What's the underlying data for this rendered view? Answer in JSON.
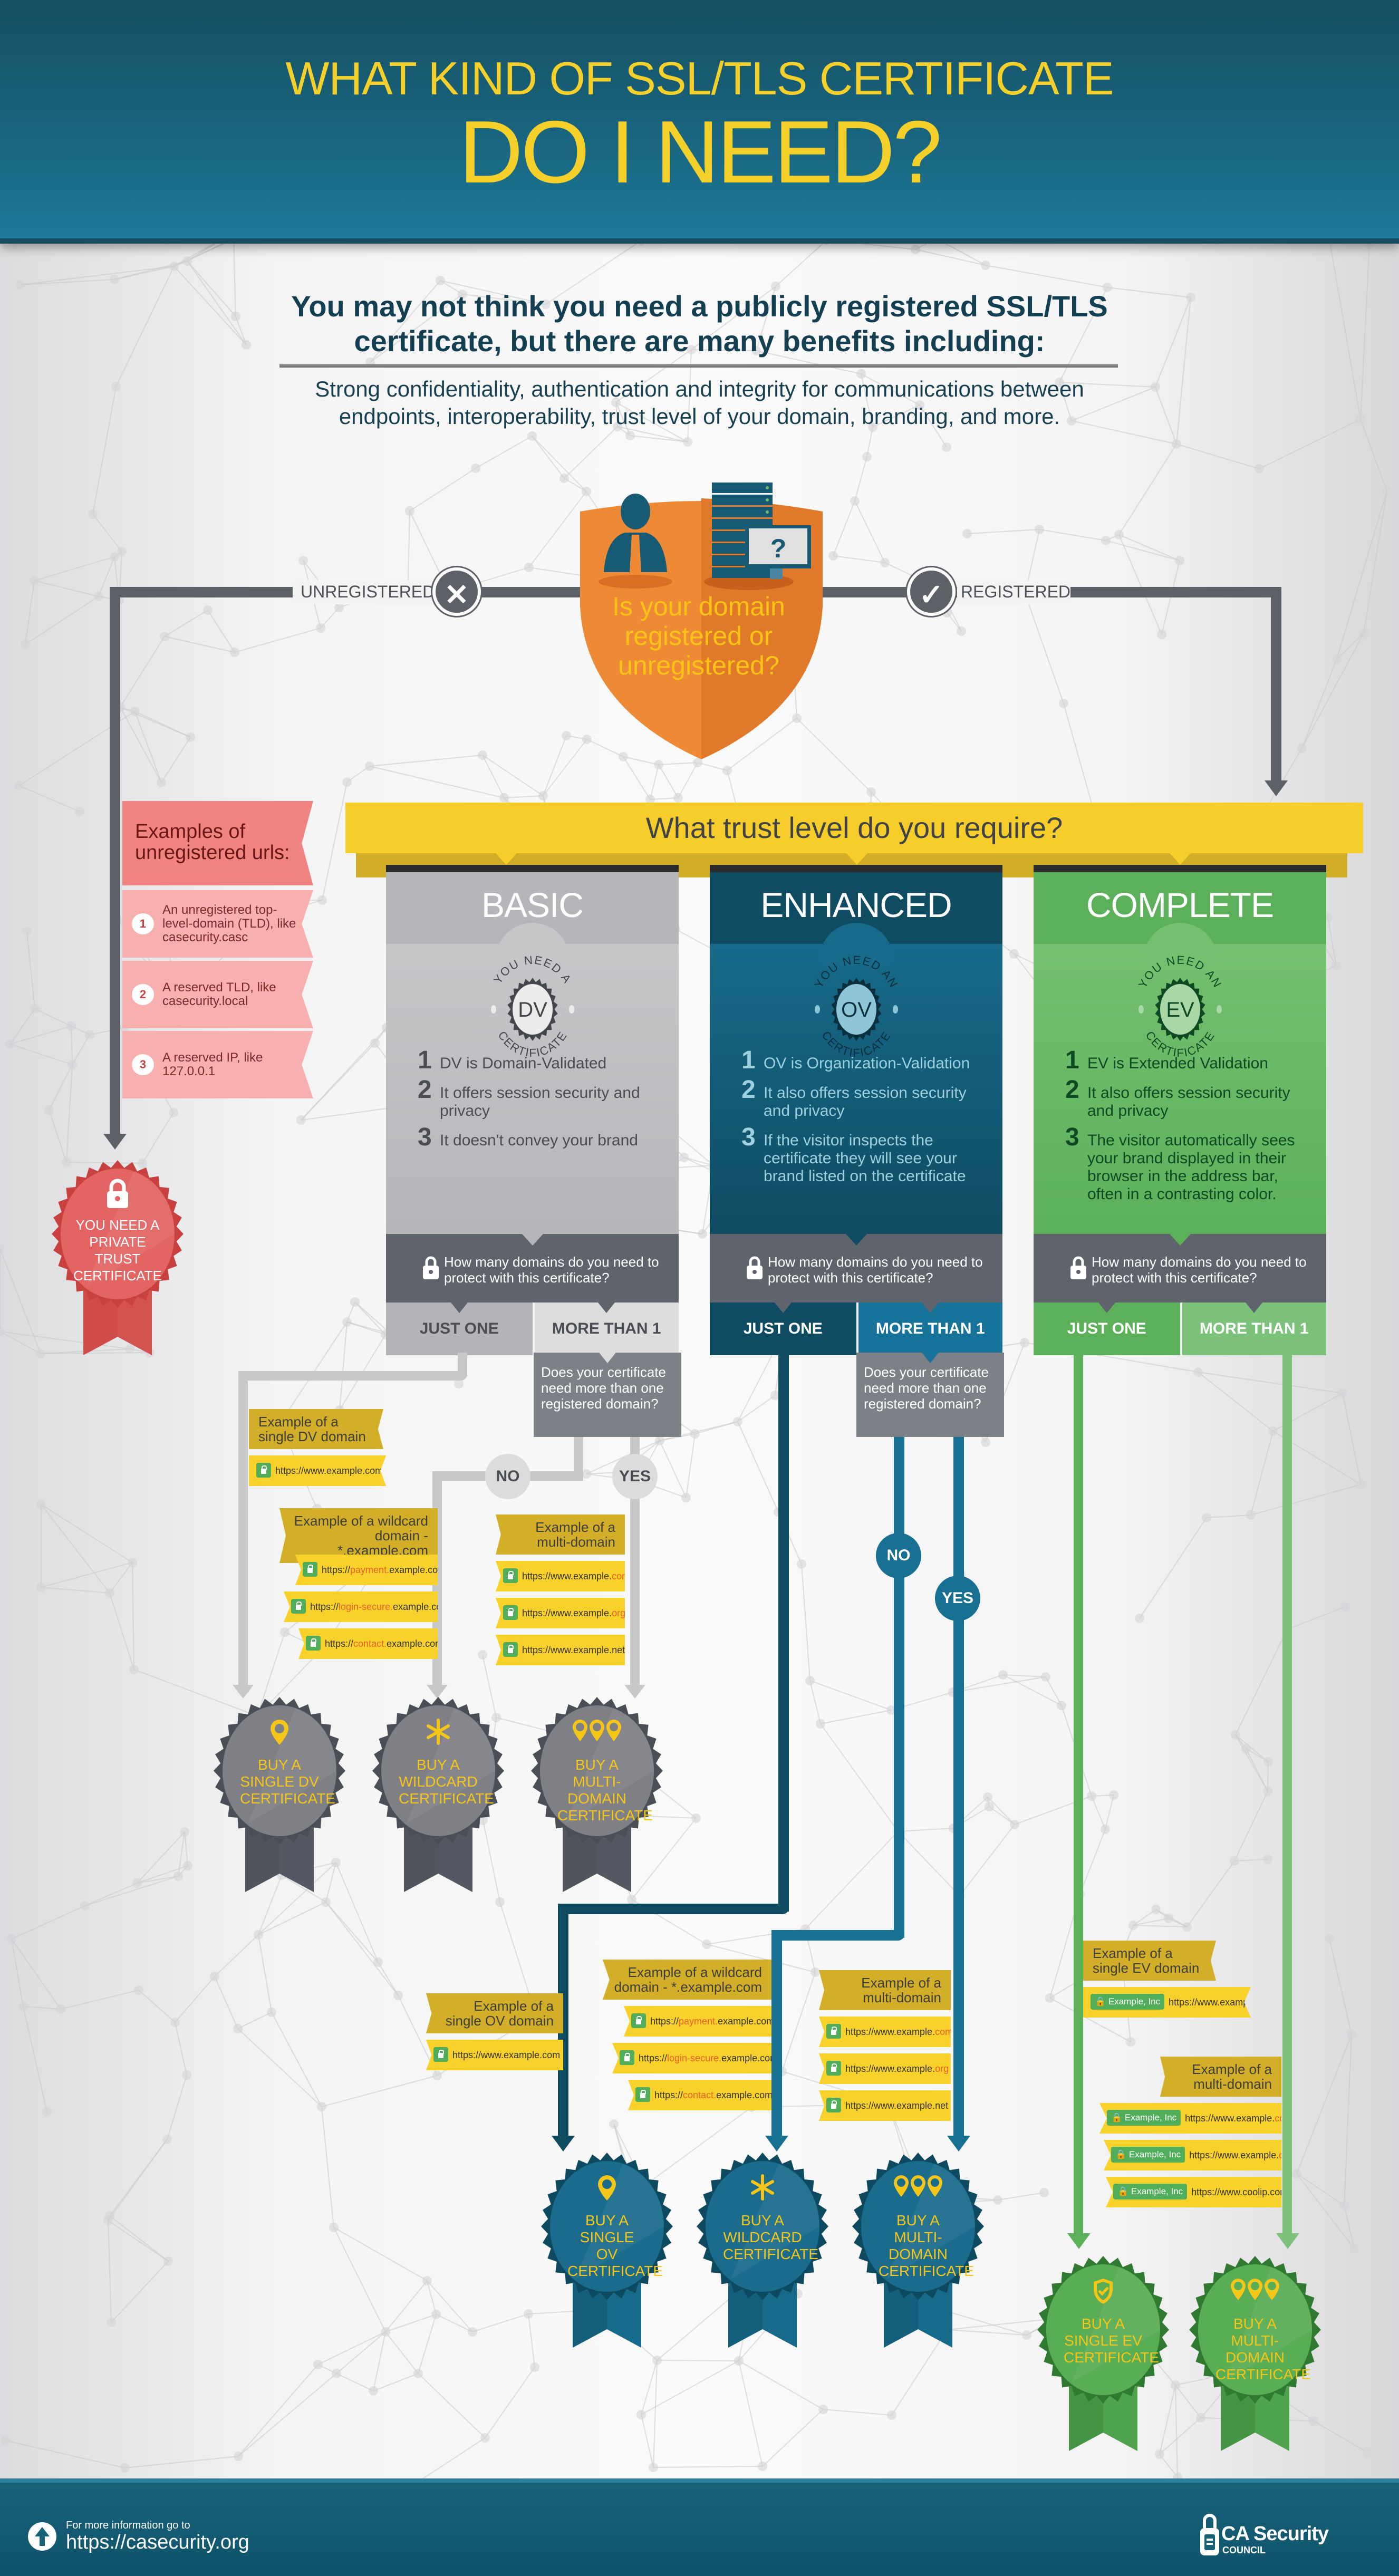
{
  "header": {
    "title_line1": "WHAT KIND OF SSL/TLS CERTIFICATE",
    "title_line2": "DO I NEED?"
  },
  "intro": {
    "headline": "You may not think you need a publicly registered SSL/TLS certificate, but there are many benefits including:",
    "body": "Strong confidentiality, authentication and integrity for communications between endpoints, interoperability, trust level of your domain, branding, and more."
  },
  "decision": {
    "question": "Is your domain registered or unregistered?",
    "unregistered_label": "UNREGISTERED",
    "registered_label": "REGISTERED",
    "unregistered_icon": "x-icon",
    "registered_icon": "check-icon"
  },
  "unregistered": {
    "heading": "Examples of unregistered urls:",
    "items": [
      {
        "num": "1",
        "text": "An unregistered top-level-domain (TLD), like casecurity.casc"
      },
      {
        "num": "2",
        "text": "A reserved TLD, like casecurity.local"
      },
      {
        "num": "3",
        "text": "A reserved IP, like 127.0.0.1"
      }
    ],
    "result": "YOU NEED A PRIVATE TRUST CERTIFICATE"
  },
  "trust": {
    "question": "What trust level do you require?",
    "domains_question": "How many domains do you need to protect with this certificate?",
    "option_one": "JUST ONE",
    "option_many": "MORE THAN 1",
    "multi_question": "Does your certificate need more than one registered domain?",
    "no_label": "NO",
    "yes_label": "YES",
    "levels": [
      {
        "name": "BASIC",
        "seal_top": "YOU NEED A",
        "seal_code": "DV",
        "seal_bottom": "CERTIFICATE",
        "features": [
          "DV is Domain-Validated",
          "It offers session security and privacy",
          "It doesn't convey your brand"
        ],
        "colors": {
          "head": "#b6b6ba",
          "body": "#c6c6c9",
          "text": "#4a4d53",
          "opt_one": "#b4b4b8",
          "opt_many": "#dcdcdc",
          "line": "#c8c8cb"
        }
      },
      {
        "name": "ENHANCED",
        "seal_top": "YOU NEED AN",
        "seal_code": "OV",
        "seal_bottom": "CERTIFICATE",
        "features": [
          "OV is Organization-Validation",
          "It also offers session security and privacy",
          "If the visitor inspects the certificate they will see your brand listed on the certificate"
        ],
        "colors": {
          "head": "#0f4b61",
          "body": "#176a8a",
          "text": "#9ed0df",
          "opt_one": "#0f4b61",
          "opt_many": "#18739a",
          "line": "#176f92"
        }
      },
      {
        "name": "COMPLETE",
        "seal_top": "YOU NEED AN",
        "seal_code": "EV",
        "seal_bottom": "CERTIFICATE",
        "features": [
          "EV is Extended Validation",
          "It also offers session security and privacy",
          "The visitor automatically sees your brand displayed in their browser in the address bar, often in a contrasting color."
        ],
        "colors": {
          "head": "#5cb05a",
          "body": "#74c070",
          "text": "#0d4a24",
          "opt_one": "#5cb05a",
          "opt_many": "#7cc27a",
          "line": "#5cb05a"
        }
      }
    ]
  },
  "examples": {
    "dv_single": {
      "heading": "Example of a single DV domain",
      "urls": [
        {
          "pre": "https://www.example.com",
          "hi": "",
          "post": ""
        }
      ]
    },
    "dv_wildcard": {
      "heading": "Example of a wildcard domain - *.example.com",
      "urls": [
        {
          "pre": "https://",
          "hi": "payment.",
          "post": "example.com"
        },
        {
          "pre": "https://",
          "hi": "login-secure.",
          "post": "example.com"
        },
        {
          "pre": "https://",
          "hi": "contact.",
          "post": "example.com"
        }
      ]
    },
    "dv_multi": {
      "heading": "Example of a multi-domain",
      "urls": [
        {
          "pre": "https://www.example.",
          "hi": "com",
          "post": ""
        },
        {
          "pre": "https://www.example.",
          "hi": "org",
          "post": ""
        },
        {
          "pre": "https://www.example.net",
          "hi": "",
          "post": ""
        }
      ]
    },
    "ov_single": {
      "heading": "Example of a single OV domain",
      "urls": [
        {
          "pre": "https://www.example.com",
          "hi": "",
          "post": ""
        }
      ]
    },
    "ov_wildcard": {
      "heading": "Example of a wildcard domain - *.example.com",
      "urls": [
        {
          "pre": "https://",
          "hi": "payment.",
          "post": "example.com"
        },
        {
          "pre": "https://",
          "hi": "login-secure.",
          "post": "example.com"
        },
        {
          "pre": "https://",
          "hi": "contact.",
          "post": "example.com"
        }
      ]
    },
    "ov_multi": {
      "heading": "Example of a multi-domain",
      "urls": [
        {
          "pre": "https://www.example.",
          "hi": "com",
          "post": ""
        },
        {
          "pre": "https://www.example.",
          "hi": "org",
          "post": ""
        },
        {
          "pre": "https://www.example.net",
          "hi": "",
          "post": ""
        }
      ]
    },
    "ev_single": {
      "heading": "Example of a single EV domain",
      "org": "Example, Inc",
      "urls": [
        {
          "pre": "https://www.example.com",
          "hi": "",
          "post": ""
        }
      ]
    },
    "ev_multi": {
      "heading": "Example of a multi-domain",
      "org": "Example, Inc",
      "urls": [
        {
          "pre": "https://www.example.",
          "hi": "com",
          "post": ""
        },
        {
          "pre": "https://www.example.",
          "hi": "org",
          "post": ""
        },
        {
          "pre": "https://www.coolip.com",
          "hi": "",
          "post": ""
        }
      ]
    }
  },
  "badges": {
    "dv_single": "BUY A SINGLE DV CERTIFICATE",
    "dv_wildcard": "BUY A WILDCARD CERTIFICATE",
    "dv_multi": "BUY A MULTI-DOMAIN CERTIFICATE",
    "ov_single": "BUY A SINGLE OV CERTIFICATE",
    "ov_wildcard": "BUY A WILDCARD CERTIFICATE",
    "ov_multi": "BUY A MULTI-DOMAIN CERTIFICATE",
    "ev_single": "BUY A SINGLE EV CERTIFICATE",
    "ev_multi": "BUY A MULTI-DOMAIN CERTIFICATE"
  },
  "colors": {
    "accent_yellow": "#f6cd2a",
    "orange_shield": "#ee8a36",
    "teal_dark": "#0f4b61",
    "teal": "#176f92",
    "green": "#5cb05a",
    "gray": "#5d6167",
    "pink": "#ef8481"
  },
  "footer": {
    "info_label": "For more information go to",
    "url": "https://casecurity.org",
    "logo_title": "CA Security",
    "logo_sub": "COUNCIL"
  }
}
